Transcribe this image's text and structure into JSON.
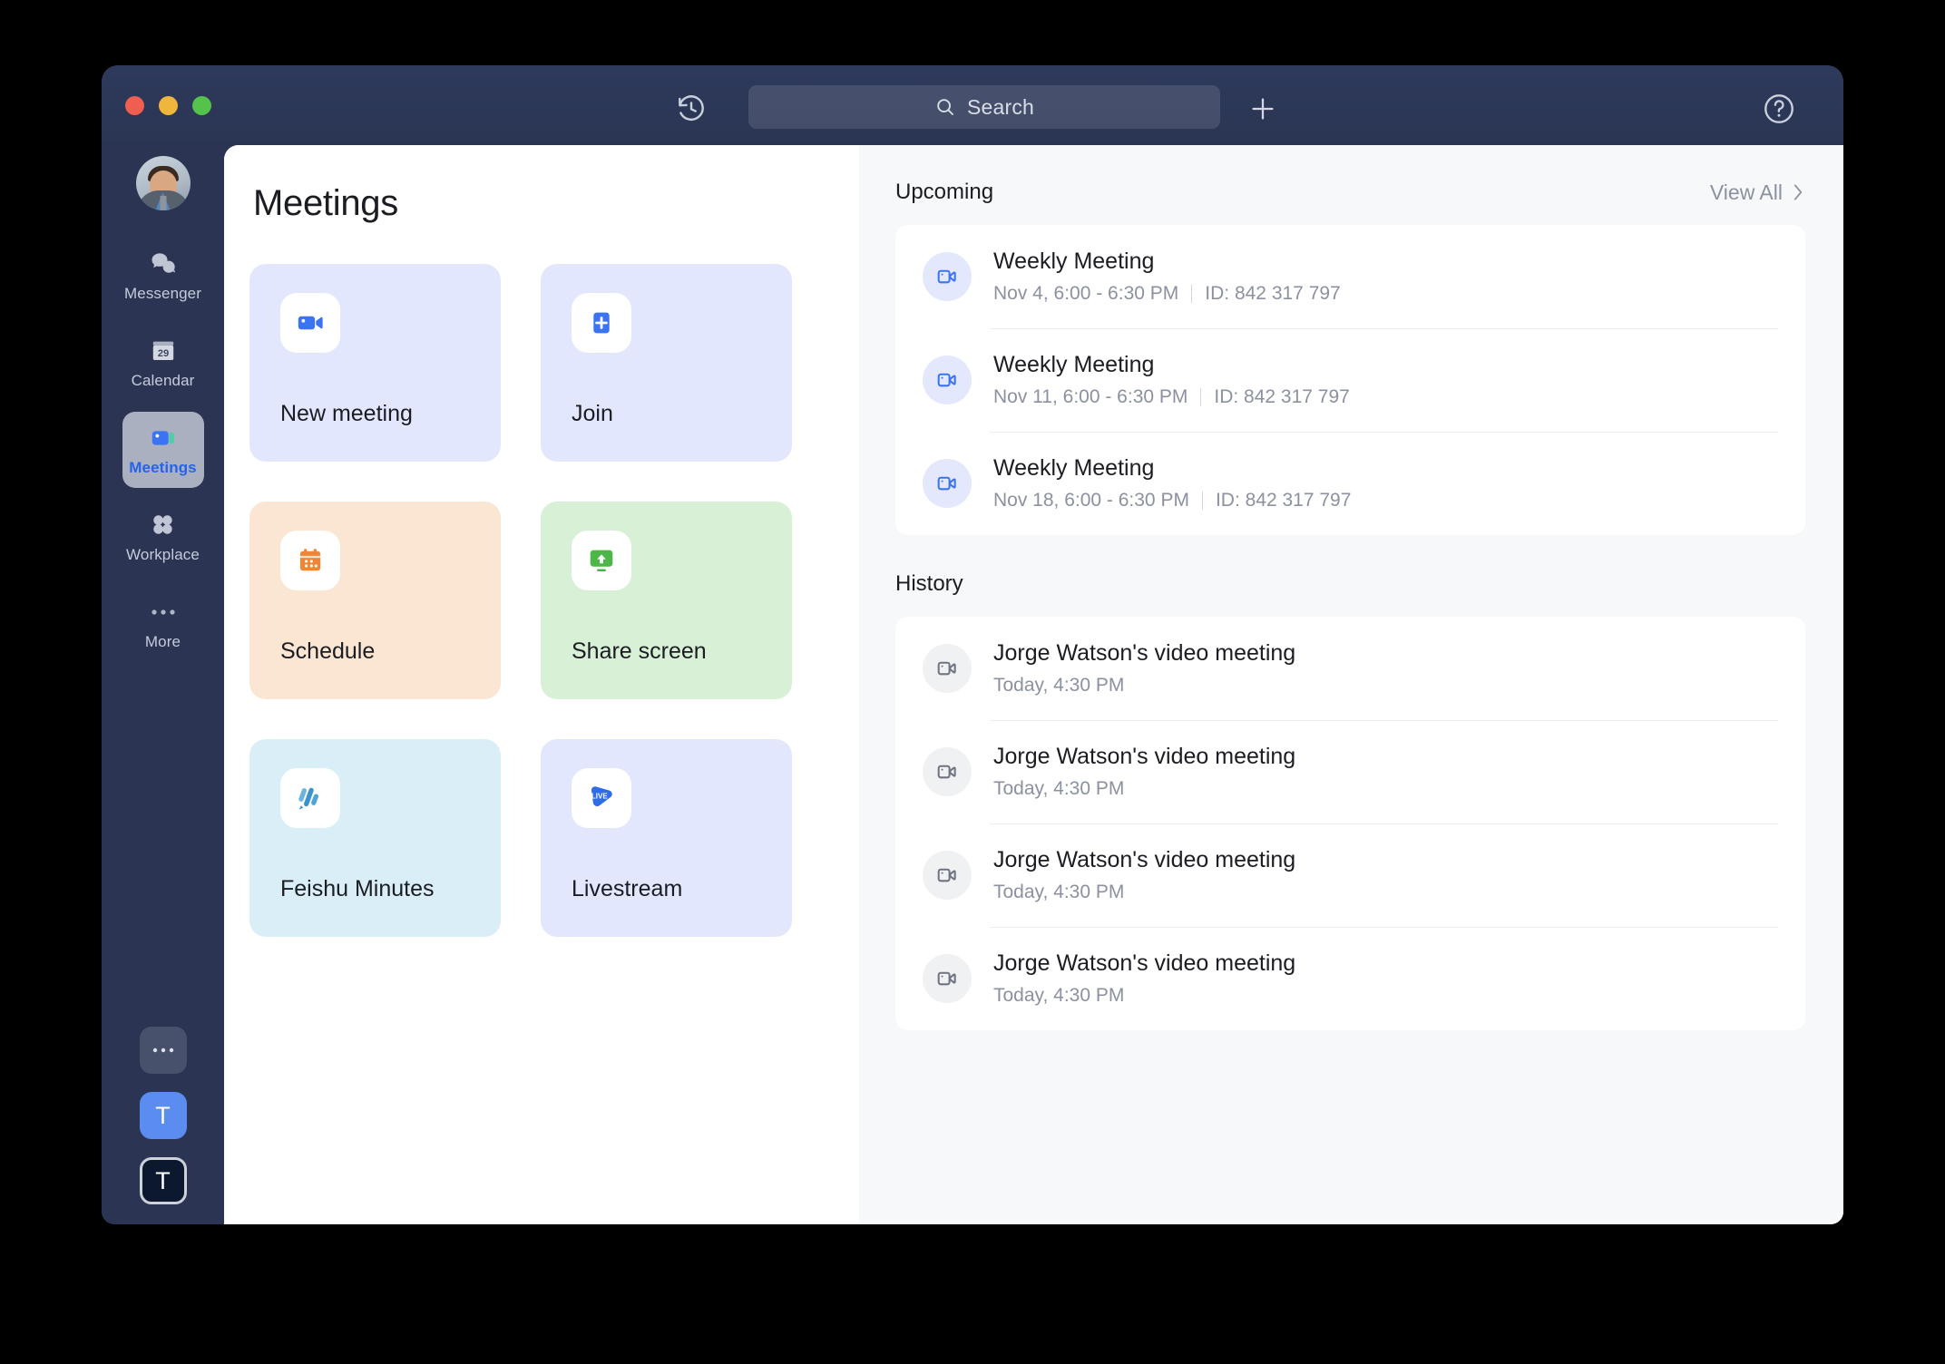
{
  "titlebar": {
    "history_icon": "history-clock-icon",
    "search_placeholder": "Search",
    "search_value": "",
    "add_icon": "plus-icon",
    "help_icon": "question-circle-icon",
    "traffic_lights": [
      "close",
      "minimize",
      "maximize"
    ]
  },
  "sidebar": {
    "avatar_alt": "user-avatar",
    "items": [
      {
        "label": "Messenger",
        "icon": "chat-bubbles-icon",
        "active": false
      },
      {
        "label": "Calendar",
        "icon": "calendar-29-icon",
        "active": false
      },
      {
        "label": "Meetings",
        "icon": "video-camera-icon",
        "active": true
      },
      {
        "label": "Workplace",
        "icon": "grid-four-dots-icon",
        "active": false
      },
      {
        "label": "More",
        "icon": "ellipsis-icon",
        "active": false
      }
    ],
    "calendar_day": "29",
    "bottom": [
      {
        "label": "•••",
        "name": "more-apps-button"
      },
      {
        "label": "T",
        "name": "tenant-button-1"
      },
      {
        "label": "T",
        "name": "tenant-button-2"
      }
    ]
  },
  "main": {
    "title": "Meetings",
    "cards": [
      {
        "label": "New meeting",
        "icon": "video-camera-icon",
        "theme": "c-lav"
      },
      {
        "label": "Join",
        "icon": "plus-square-icon",
        "theme": "c-lav"
      },
      {
        "label": "Schedule",
        "icon": "calendar-icon",
        "theme": "c-orange"
      },
      {
        "label": "Share screen",
        "icon": "screen-share-icon",
        "theme": "c-green"
      },
      {
        "label": "Feishu Minutes",
        "icon": "minutes-waveform-icon",
        "theme": "c-cyan"
      },
      {
        "label": "Livestream",
        "icon": "live-play-icon",
        "theme": "c-lav"
      }
    ]
  },
  "upcoming": {
    "title": "Upcoming",
    "view_all": "View All",
    "items": [
      {
        "title": "Weekly Meeting",
        "date": "Nov 4, 6:00 - 6:30 PM",
        "id": "ID: 842 317 797"
      },
      {
        "title": "Weekly Meeting",
        "date": "Nov 11, 6:00 - 6:30 PM",
        "id": "ID: 842 317 797"
      },
      {
        "title": "Weekly Meeting",
        "date": "Nov 18, 6:00 - 6:30 PM",
        "id": "ID: 842 317 797"
      }
    ]
  },
  "history": {
    "title": "History",
    "items": [
      {
        "title": "Jorge Watson's video meeting",
        "time": "Today, 4:30 PM"
      },
      {
        "title": "Jorge Watson's video meeting",
        "time": "Today, 4:30 PM"
      },
      {
        "title": "Jorge Watson's video meeting",
        "time": "Today, 4:30 PM"
      },
      {
        "title": "Jorge Watson's video meeting",
        "time": "Today, 4:30 PM"
      }
    ]
  },
  "colors": {
    "window_chrome": "#2b3553",
    "accent_blue": "#2563eb",
    "card_lavender": "#e3e7fd",
    "card_orange": "#fae6d2",
    "card_green": "#d8f0d6",
    "card_cyan": "#d9eef7",
    "right_pane_bg": "#f7f8fa"
  }
}
